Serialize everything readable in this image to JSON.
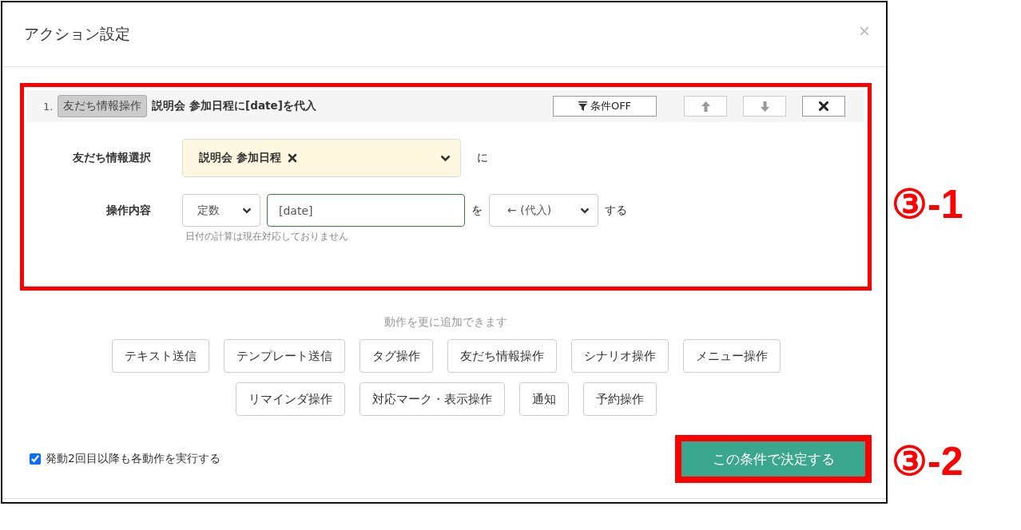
{
  "dialog": {
    "title": "アクション設定",
    "close": "×"
  },
  "action": {
    "number": "1.",
    "type_button": "友だち情報操作",
    "summary": "説明会 参加日程に[date]を代入",
    "condition_button": "条件OFF",
    "highlighted": true,
    "tools": [
      {
        "kind": "up",
        "disabled": true
      },
      {
        "kind": "down",
        "disabled": true
      },
      {
        "kind": "delete",
        "disabled": false
      }
    ],
    "friend_info": {
      "label": "友だち情報選択",
      "tag": "説明会 参加日程",
      "suffix": "に"
    },
    "operation": {
      "label": "操作内容",
      "mode": "定数",
      "value": "[date]",
      "particle": "を",
      "operator": "← (代入)",
      "suffix": "する",
      "hint": "日付の計算は現在対応しておりません"
    }
  },
  "add_actions": {
    "hint": "動作を更に追加できます",
    "buttons": [
      "テキスト送信",
      "テンプレート送信",
      "タグ操作",
      "友だち情報操作",
      "シナリオ操作",
      "メニュー操作",
      "リマインダ操作",
      "対応マーク・表示操作",
      "通知",
      "予約操作"
    ]
  },
  "repeat_option": {
    "label": "発動2回目以降も各動作を実行する",
    "checked": true
  },
  "submit": {
    "label": "この条件で決定する",
    "highlighted": true
  },
  "action_annotation": "③-1",
  "submit_annotation": "③-2"
}
